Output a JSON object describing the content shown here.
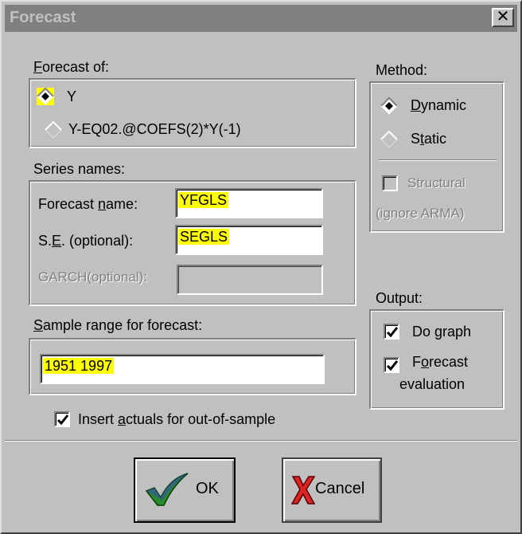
{
  "window": {
    "title": "Forecast",
    "close_symbol": "✕"
  },
  "forecast_of": {
    "label_u": "F",
    "label_rest": "orecast of:",
    "options": [
      {
        "label": "Y",
        "selected": true
      },
      {
        "label": "Y-EQ02.@COEFS(2)*Y(-1)",
        "selected": false
      }
    ]
  },
  "series_names": {
    "label": "Series names:",
    "forecast_name": {
      "pre": "Forecast ",
      "u": "n",
      "post": "ame:",
      "value": "YFGLS"
    },
    "se": {
      "pre": "S.",
      "u": "E",
      "post": ". (optional):",
      "value": "SEGLS"
    },
    "garch": {
      "label": "GARCH(optional):",
      "value": ""
    }
  },
  "sample_range": {
    "label_u": "S",
    "label_rest": "ample range for forecast:",
    "value": "1951 1997"
  },
  "insert_actuals": {
    "pre": "Insert ",
    "u": "a",
    "post": "ctuals for out-of-sample",
    "checked": true
  },
  "method": {
    "label": "Method:",
    "dynamic": {
      "u": "D",
      "rest": "ynamic",
      "selected": true
    },
    "static": {
      "pre": "S",
      "u": "t",
      "rest": "atic",
      "selected": false
    },
    "structural": {
      "label": "Structural",
      "sub": "(ignore ARMA)",
      "checked": false
    }
  },
  "output": {
    "label": "Output:",
    "do_graph": {
      "label": "Do graph",
      "checked": true
    },
    "forecast_eval": {
      "pre": "F",
      "u": "o",
      "rest": "recast",
      "line2": "evaluation",
      "checked": true
    }
  },
  "buttons": {
    "ok": "OK",
    "cancel": "Cancel"
  },
  "colors": {
    "highlight": "#ffff00",
    "face": "#c0c0c0",
    "title_bar": "#808080"
  }
}
